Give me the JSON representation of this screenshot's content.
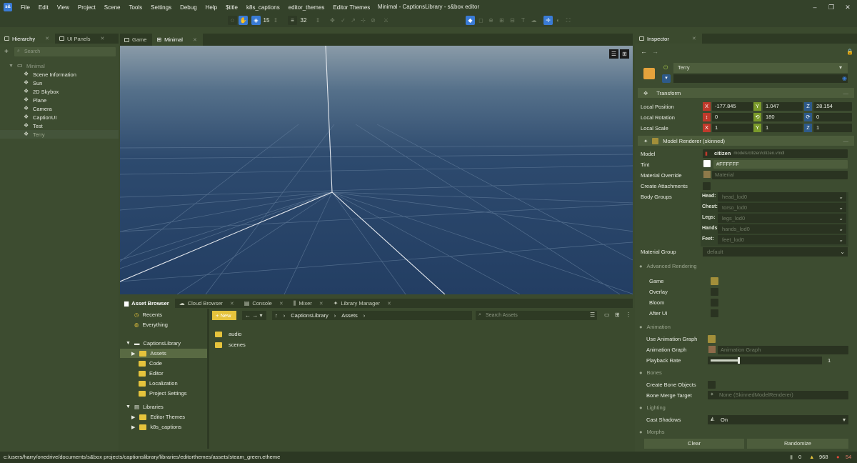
{
  "app": {
    "window_title": "Minimal - CaptionsLibrary - s&box editor",
    "logo": "s&",
    "menu": [
      "File",
      "Edit",
      "View",
      "Project",
      "Scene",
      "Tools",
      "Settings",
      "Debug",
      "Help",
      "$title",
      "k8s_captions",
      "editor_themes",
      "Editor Themes"
    ]
  },
  "toolbar": {
    "grid_value": "15",
    "size_value": "32"
  },
  "hierarchy": {
    "tabs": [
      "Hierarchy",
      "UI Panels"
    ],
    "search_placeholder": "Search",
    "root": "Minimal",
    "items": [
      "Scene Information",
      "Sun",
      "2D Skybox",
      "Plane",
      "Camera",
      "CaptionUI",
      "Test",
      "Terry"
    ]
  },
  "viewport": {
    "tabs": [
      "Game",
      "Minimal"
    ]
  },
  "inspector": {
    "tab": "Inspector",
    "object_name": "Terry",
    "transform": {
      "title": "Transform",
      "local_position_label": "Local Position",
      "local_rotation_label": "Local Rotation",
      "local_scale_label": "Local Scale",
      "axis_x": "X",
      "axis_y": "Y",
      "axis_z": "Z",
      "position": [
        "-177.845",
        "1.047",
        "28.154"
      ],
      "rotation": [
        "0",
        "180",
        "0"
      ],
      "scale": [
        "1",
        "1",
        "1"
      ]
    },
    "model_renderer": {
      "title": "Model Renderer (skinned)",
      "model_label": "Model",
      "model_name": "citizen",
      "model_path": "models/citizen/citizen.vmdl",
      "tint_label": "Tint",
      "tint_value": "#FFFFFF",
      "tint_color": "#FFFFFF",
      "material_override_label": "Material Override",
      "material_placeholder": "Material",
      "create_attachments_label": "Create Attachments",
      "body_groups_label": "Body Groups",
      "body_groups": [
        {
          "label": "Head:",
          "value": "head_lod0"
        },
        {
          "label": "Chest:",
          "value": "torso_lod0"
        },
        {
          "label": "Legs:",
          "value": "legs_lod0"
        },
        {
          "label": "Hands:",
          "value": "hands_lod0"
        },
        {
          "label": "Feet:",
          "value": "feet_lod0"
        }
      ],
      "material_group_label": "Material Group",
      "material_group_value": "default",
      "advanced_rendering": "Advanced Rendering",
      "render_flags": [
        {
          "label": "Game",
          "checked": true
        },
        {
          "label": "Overlay",
          "checked": false
        },
        {
          "label": "Bloom",
          "checked": false
        },
        {
          "label": "After UI",
          "checked": false
        }
      ],
      "animation_section": "Animation",
      "use_animation_graph_label": "Use Animation Graph",
      "animation_graph_label": "Animation Graph",
      "animation_graph_placeholder": "Animation Graph",
      "playback_rate_label": "Playback Rate",
      "playback_rate_value": "1",
      "playback_rate_fraction": 0.25,
      "bones_section": "Bones",
      "create_bone_objects_label": "Create Bone Objects",
      "bone_merge_target_label": "Bone Merge Target",
      "bone_merge_target_value": "None (SkinnedModelRenderer)",
      "lighting_section": "Lighting",
      "cast_shadows_label": "Cast Shadows",
      "cast_shadows_value": "On",
      "morphs_section": "Morphs",
      "clear_button": "Clear",
      "randomize_button": "Randomize"
    }
  },
  "bottom_tabs": [
    "Asset Browser",
    "Cloud Browser",
    "Console",
    "Mixer",
    "Library Manager"
  ],
  "asset_browser": {
    "recents": "Recents",
    "everything": "Everything",
    "project": "CaptionsLibrary",
    "project_folders": [
      "Assets",
      "Code",
      "Editor",
      "Localization",
      "Project Settings"
    ],
    "libraries": "Libraries",
    "library_items": [
      "Editor Themes",
      "k8s_captions"
    ],
    "new_button": "New",
    "breadcrumb": [
      "CaptionsLibrary",
      "Assets"
    ],
    "search_placeholder": "Search Assets",
    "files": [
      "audio",
      "scenes"
    ]
  },
  "status": {
    "path": "c:/users/harry/onedrive/documents/s&box projects/captionslibrary/libraries/editorthemes/assets/steam_green.etheme",
    "info_count": "0",
    "warning_count": "968",
    "error_count": "54"
  }
}
